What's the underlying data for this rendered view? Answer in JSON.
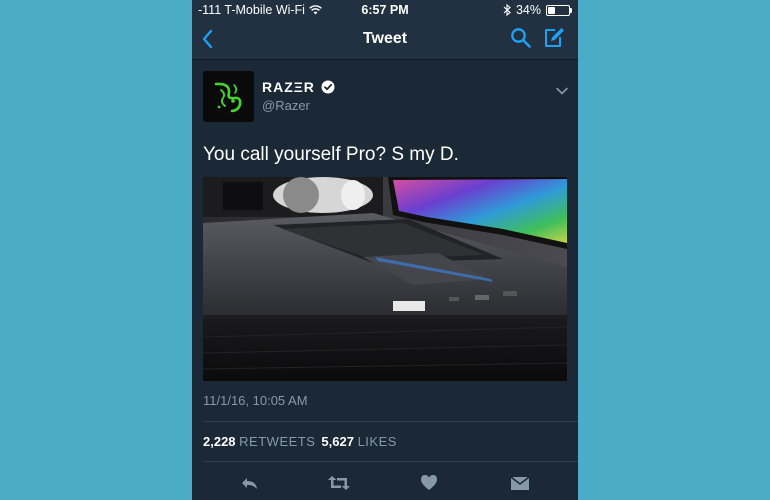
{
  "status_bar": {
    "carrier": "-111 T-Mobile Wi-Fi",
    "time": "6:57 PM",
    "battery": "34%",
    "battery_level": 0.34
  },
  "nav": {
    "title": "Tweet"
  },
  "tweet": {
    "display_name": "RAZΞR",
    "handle": "@Razer",
    "text": "You call yourself Pro? S my D.",
    "timestamp": "11/1/16, 10:05 AM",
    "retweets_count": "2,228",
    "retweets_label": "RETWEETS",
    "likes_count": "5,627",
    "likes_label": "LIKES"
  },
  "colors": {
    "background": "#4bacc8",
    "app_background": "#1b2836",
    "accent": "#1da1f2",
    "secondary_text": "#8899a6",
    "razer_green": "#44d62c"
  },
  "icons": {
    "back": "chevron-left-icon",
    "search": "search-icon",
    "compose": "compose-icon",
    "reply": "reply-icon",
    "retweet": "retweet-icon",
    "like": "heart-icon",
    "dm": "envelope-icon"
  }
}
